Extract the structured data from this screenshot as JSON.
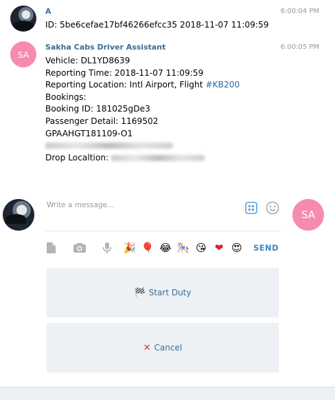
{
  "messages": [
    {
      "sender": "A",
      "time": "6:00:04 PM",
      "lines": [
        "ID: 5be6cefae17bf46266efcc35 2018-11-07 11:09:59"
      ]
    },
    {
      "sender": "Sakha Cabs Driver Assistant",
      "avatar_initials": "SA",
      "time": "6:00:05 PM",
      "lines": [
        "Vehicle: DL1YD8639",
        "Reporting Time: 2018-11-07 11:09:59",
        "Reporting Location: Intl Airport, Flight ",
        "Bookings:",
        "Booking ID: 181025gDe3",
        "Passenger Detail: 1169502",
        "GPAAHGT181109-O1",
        "Drop Localtion: "
      ],
      "hashtag": "#KB200"
    }
  ],
  "composer": {
    "placeholder": "Write a message...",
    "value": "",
    "send_label": "SEND",
    "user_avatar_initials": "SA"
  },
  "toolbar_icons": [
    "file-icon",
    "camera-icon",
    "microphone-icon",
    "party-popper-emoji",
    "balloon-emoji",
    "tears-of-joy-emoji",
    "carousel-emoji",
    "kiss-emoji",
    "heart-emoji",
    "heart-eyes-emoji"
  ],
  "keyboard_buttons": [
    {
      "label": "Start Duty",
      "icon": "checkered-flag-icon"
    },
    {
      "label": "Cancel",
      "icon": "cross-mark-icon"
    }
  ],
  "colors": {
    "accent": "#3a6d99",
    "send": "#3d87c4",
    "avatar_pink": "#f58bb1",
    "button_bg": "#edf0f4",
    "cancel_red": "#e0303a"
  }
}
